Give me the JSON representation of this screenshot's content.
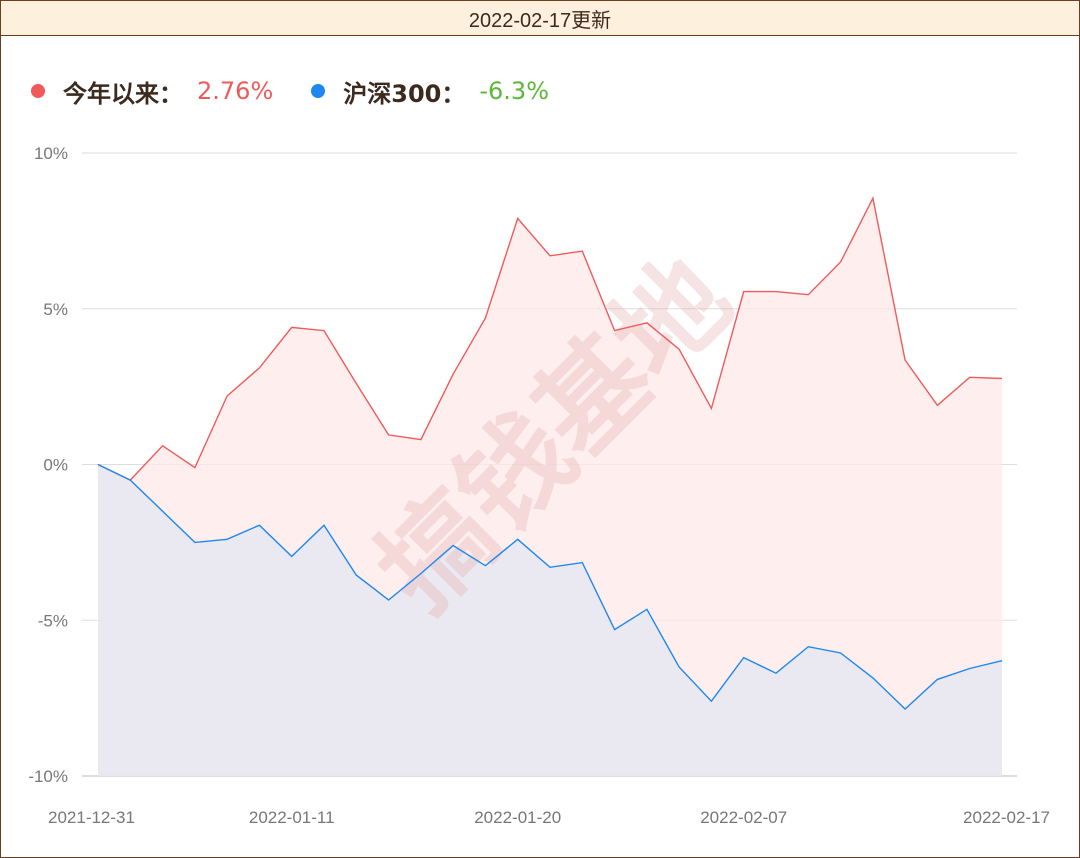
{
  "header": {
    "title": "2022-02-17更新"
  },
  "legend": [
    {
      "label": "今年以来：",
      "value": "2.76%",
      "dot_color": "#f05a5a",
      "value_color": "#f05a5a"
    },
    {
      "label": "沪深300：",
      "value": "-6.3%",
      "dot_color": "#1e88f0",
      "value_color": "#5cb83a"
    }
  ],
  "watermark": "搞钱基地",
  "chart_data": {
    "type": "area",
    "ylim": [
      -10,
      10
    ],
    "y_ticks": [
      "10%",
      "5%",
      "0%",
      "-5%",
      "-10%"
    ],
    "y_tick_values": [
      10,
      5,
      0,
      -5,
      -10
    ],
    "x_ticks": [
      "2021-12-31",
      "2022-01-11",
      "2022-01-20",
      "2022-02-07",
      "2022-02-17"
    ],
    "x_tick_indices": [
      0,
      6,
      13,
      20,
      28
    ],
    "grid": true,
    "series": [
      {
        "name": "今年以来",
        "color": "#f05a5a",
        "fill": "#fde8e8",
        "values": [
          0,
          -0.5,
          0.6,
          -0.1,
          2.2,
          3.1,
          4.4,
          4.3,
          2.6,
          0.95,
          0.8,
          2.9,
          4.7,
          7.9,
          6.7,
          6.85,
          4.3,
          4.55,
          3.7,
          1.8,
          5.55,
          5.55,
          5.45,
          6.5,
          8.55,
          3.35,
          1.9,
          2.8,
          2.76
        ]
      },
      {
        "name": "沪深300",
        "color": "#1e88f0",
        "fill": "#e6e6f0",
        "values": [
          0,
          -0.5,
          -1.5,
          -2.5,
          -2.4,
          -1.95,
          -2.95,
          -1.95,
          -3.55,
          -4.35,
          -3.5,
          -2.6,
          -3.25,
          -2.4,
          -3.3,
          -3.15,
          -5.3,
          -4.65,
          -6.5,
          -7.6,
          -6.2,
          -6.7,
          -5.85,
          -6.05,
          -6.85,
          -7.85,
          -6.9,
          -6.55,
          -6.3
        ]
      }
    ]
  }
}
